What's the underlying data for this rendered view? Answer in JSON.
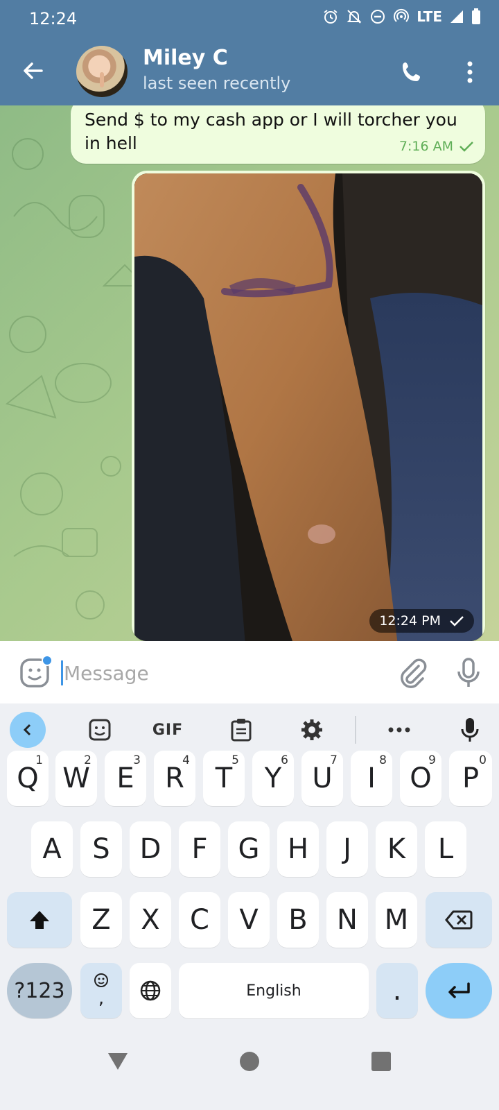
{
  "status_bar": {
    "time": "12:24",
    "network": "LTE"
  },
  "header": {
    "contact_name": "Miley C",
    "contact_status": "last seen recently"
  },
  "messages": [
    {
      "type": "text",
      "text": "Send $ to my cash app or I will torcher you in hell",
      "time": "7:16 AM",
      "status": "sent"
    },
    {
      "type": "photo",
      "time": "12:24 PM",
      "status": "sent"
    }
  ],
  "composer": {
    "placeholder": "Message",
    "value": ""
  },
  "keyboard": {
    "toolbar": {
      "gif": "GIF"
    },
    "row1": [
      {
        "key": "Q",
        "hint": "1"
      },
      {
        "key": "W",
        "hint": "2"
      },
      {
        "key": "E",
        "hint": "3"
      },
      {
        "key": "R",
        "hint": "4"
      },
      {
        "key": "T",
        "hint": "5"
      },
      {
        "key": "Y",
        "hint": "6"
      },
      {
        "key": "U",
        "hint": "7"
      },
      {
        "key": "I",
        "hint": "8"
      },
      {
        "key": "O",
        "hint": "9"
      },
      {
        "key": "P",
        "hint": "0"
      }
    ],
    "row2": [
      "A",
      "S",
      "D",
      "F",
      "G",
      "H",
      "J",
      "K",
      "L"
    ],
    "row3": [
      "Z",
      "X",
      "C",
      "V",
      "B",
      "N",
      "M"
    ],
    "symbols_label": "?123",
    "comma_label": ",",
    "space_label": "English",
    "period_label": "."
  },
  "colors": {
    "header": "#527da3",
    "bubble": "#effdde",
    "check": "#5fae57",
    "accent": "#8dcdf8"
  }
}
